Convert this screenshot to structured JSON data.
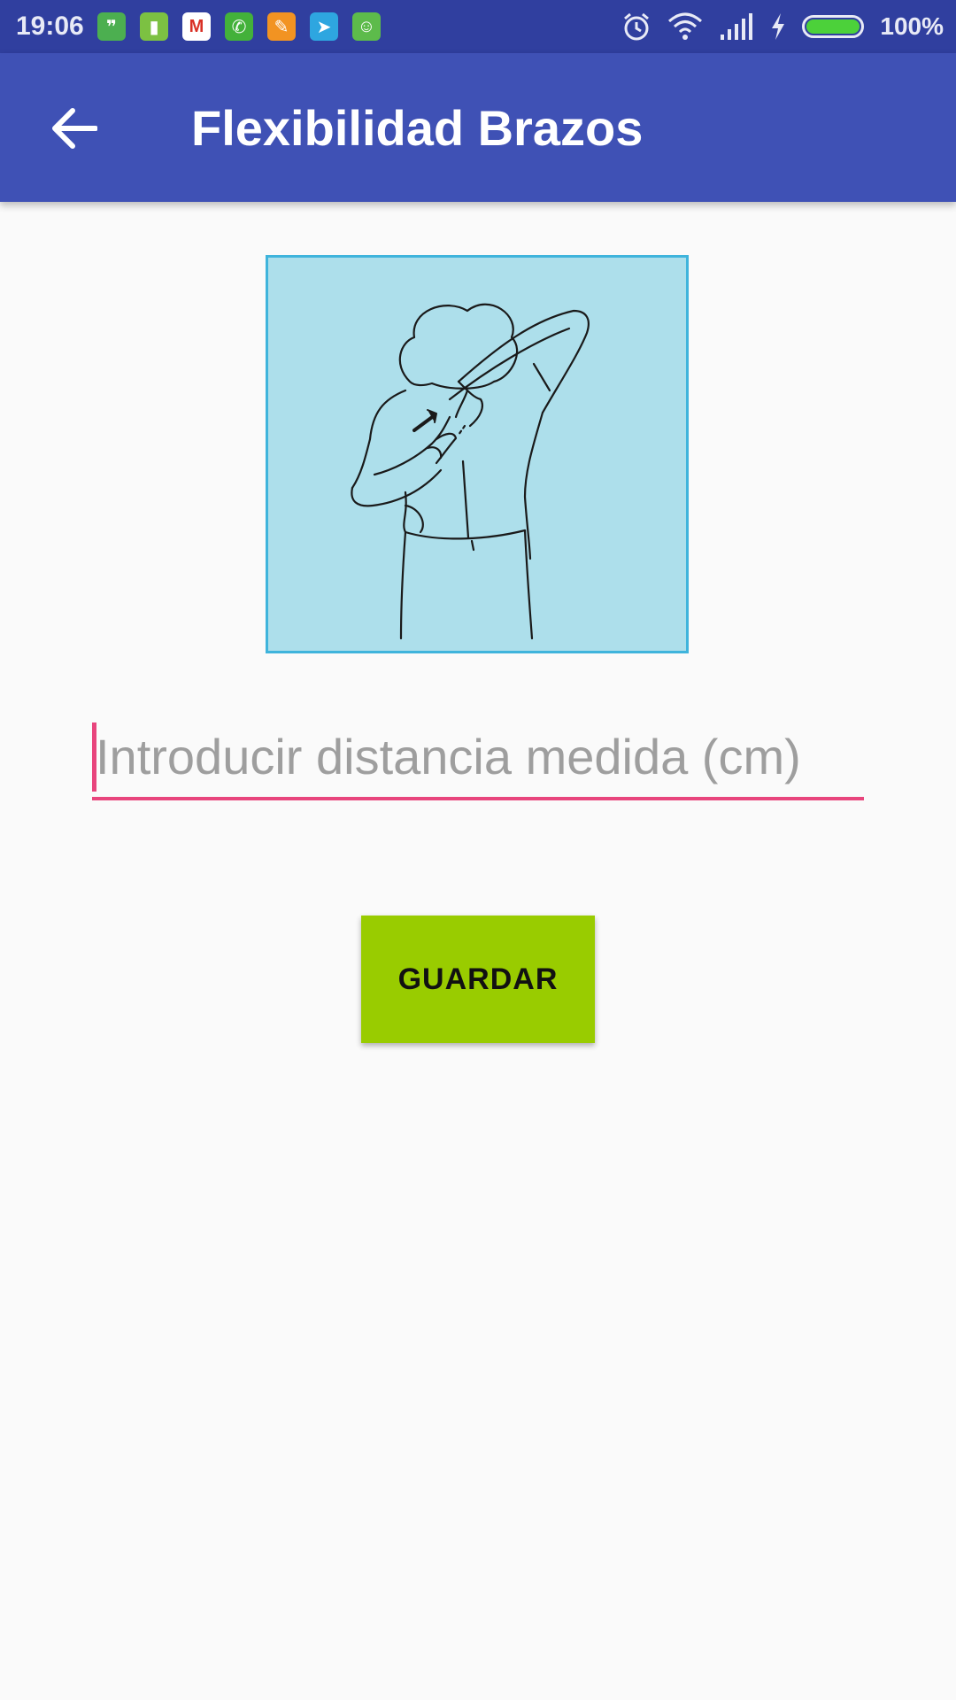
{
  "status_bar": {
    "time": "19:06",
    "battery_percent": "100%",
    "notification_icons": [
      {
        "name": "hangouts-icon",
        "color": "#4caf50",
        "glyph": "❞"
      },
      {
        "name": "battery-app-icon",
        "color": "#7cc142",
        "glyph": "▮"
      },
      {
        "name": "gmail-icon",
        "color": "#ffffff",
        "glyph": "M"
      },
      {
        "name": "whatsapp-icon",
        "color": "#43b13a",
        "glyph": "✆"
      },
      {
        "name": "cleaner-icon",
        "color": "#f29322",
        "glyph": "✎"
      },
      {
        "name": "telegram-icon",
        "color": "#2ea6e0",
        "glyph": "➤"
      },
      {
        "name": "android-app-icon",
        "color": "#5dbb4b",
        "glyph": "☺"
      }
    ],
    "system_icons": [
      "alarm-icon",
      "wifi-icon",
      "signal-icon",
      "charging-icon",
      "battery-icon"
    ]
  },
  "app_bar": {
    "title": "Flexibilidad Brazos",
    "back_icon": "arrow-back-icon"
  },
  "exercise_image": {
    "description_icon": "shoulder-stretch-illustration"
  },
  "distance_input": {
    "placeholder": "Introducir distancia medida (cm)",
    "value": ""
  },
  "save_button": {
    "label": "GUARDAR"
  },
  "colors": {
    "status_bar": "#303f9f",
    "app_bar": "#3f51b5",
    "accent": "#e8457d",
    "button": "#99cc00",
    "image_bg": "#addfeb",
    "image_border": "#3fb4dc"
  }
}
